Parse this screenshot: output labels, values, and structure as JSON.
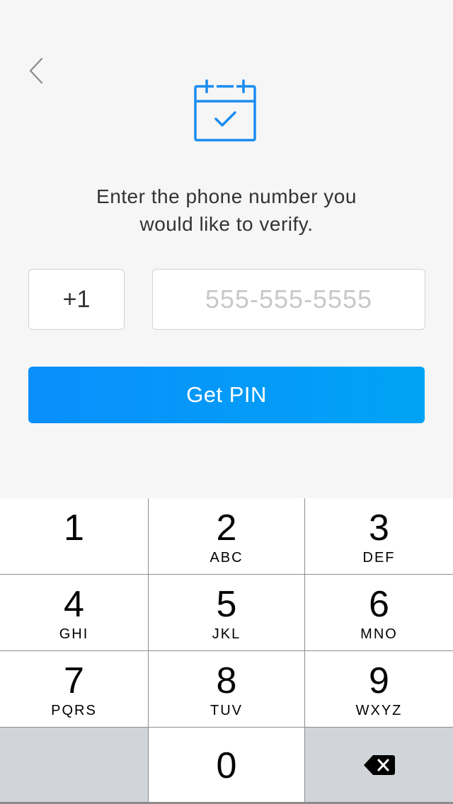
{
  "nav": {
    "back_icon": "chevron-left-icon"
  },
  "header": {
    "icon": "calendar-check-icon",
    "accent_color": "#1a8cf0"
  },
  "prompt": {
    "text": "Enter the phone number you\nwould like to verify."
  },
  "form": {
    "country_code": "+1",
    "phone_placeholder": "555-555-5555",
    "phone_value": ""
  },
  "actions": {
    "get_pin_label": "Get PIN",
    "button_color": "#0a8ffc"
  },
  "keypad": {
    "keys": [
      {
        "digit": "1",
        "letters": ""
      },
      {
        "digit": "2",
        "letters": "ABC"
      },
      {
        "digit": "3",
        "letters": "DEF"
      },
      {
        "digit": "4",
        "letters": "GHI"
      },
      {
        "digit": "5",
        "letters": "JKL"
      },
      {
        "digit": "6",
        "letters": "MNO"
      },
      {
        "digit": "7",
        "letters": "PQRS"
      },
      {
        "digit": "8",
        "letters": "TUV"
      },
      {
        "digit": "9",
        "letters": "WXYZ"
      },
      {
        "digit": "0",
        "letters": ""
      }
    ],
    "delete_icon": "backspace-icon"
  }
}
